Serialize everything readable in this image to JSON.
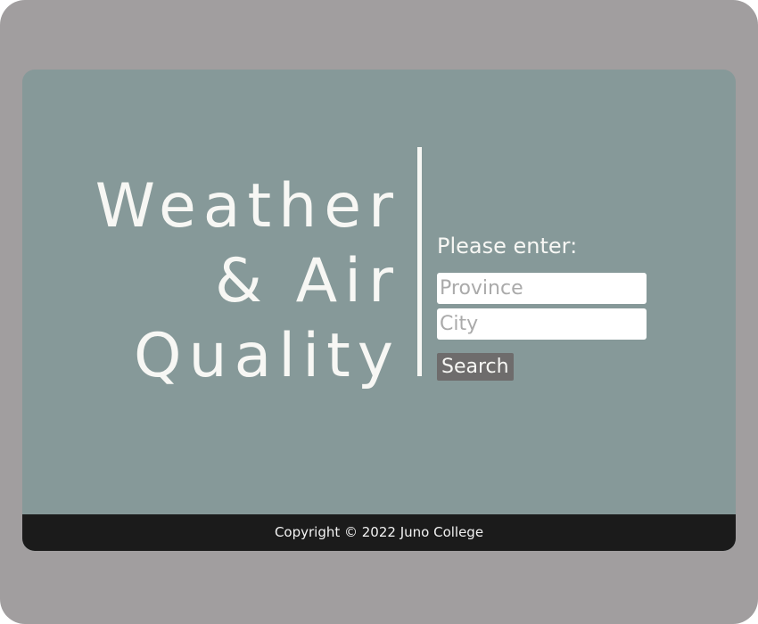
{
  "header": {
    "title_lines": [
      "Weather",
      "& Air",
      "Quality"
    ]
  },
  "search_form": {
    "prompt": "Please enter:",
    "province_placeholder": "Province",
    "city_placeholder": "City",
    "search_label": "Search"
  },
  "footer": {
    "copyright": "Copyright © 2022 Juno College"
  },
  "colors": {
    "outer_background": "#a19e9f",
    "card_background": "#869999",
    "text": "#f7f7f4",
    "button_background": "#6e6c6c",
    "footer_background": "#1b1b1b"
  }
}
